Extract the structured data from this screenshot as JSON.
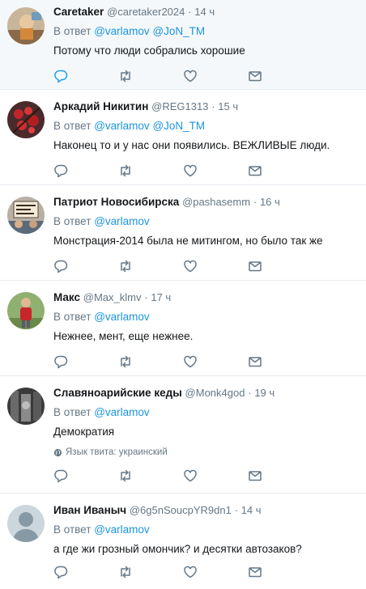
{
  "reply_prefix": "В ответ",
  "tweets": [
    {
      "name": "Caretaker",
      "handle": "@caretaker2024",
      "separator": "·",
      "time": "14 ч",
      "mentions": [
        "@varlamov",
        "@JoN_TM"
      ],
      "text": "Потому что люди собрались хорошие",
      "highlighted": true,
      "reply_active": true
    },
    {
      "name": "Аркадий Никитин",
      "handle": "@REG1313",
      "separator": "·",
      "time": "15 ч",
      "mentions": [
        "@varlamov",
        "@JoN_TM"
      ],
      "text": "Наконец то и у нас они появились. ВЕЖЛИВЫЕ люди."
    },
    {
      "name": "Патриот Новосибирска",
      "handle": "@pashasemm",
      "separator": "·",
      "time": "16 ч",
      "mentions": [
        "@varlamov"
      ],
      "text": "Монстрация-2014 была не митингом, но было так же"
    },
    {
      "name": "Макс",
      "handle": "@Max_klmv",
      "separator": "·",
      "time": "17 ч",
      "mentions": [
        "@varlamov"
      ],
      "text": "Нежнее, мент, еще нежнее."
    },
    {
      "name": "Славяноарийские кеды",
      "handle": "@Monk4god",
      "separator": "·",
      "time": "19 ч",
      "mentions": [
        "@varlamov"
      ],
      "text": "Демократия",
      "language_note": "Язык твита: украинский"
    },
    {
      "name": "Иван Иваныч",
      "handle": "@6g5nSoucpYR9dn1",
      "separator": "·",
      "time": "14 ч",
      "mentions": [
        "@varlamov"
      ],
      "text": "а где жи грозный омончик? и десятки автозаков?"
    }
  ],
  "icons": {
    "reply": "reply-icon",
    "retweet": "retweet-icon",
    "like": "heart-icon",
    "message": "envelope-icon",
    "globe": "globe-icon"
  },
  "colors": {
    "icon": "#657786",
    "icon_active": "#1da1f2",
    "mention": "#1b95e0",
    "highlight_bg": "#f5f8fa",
    "divider": "#e6ecf0"
  }
}
